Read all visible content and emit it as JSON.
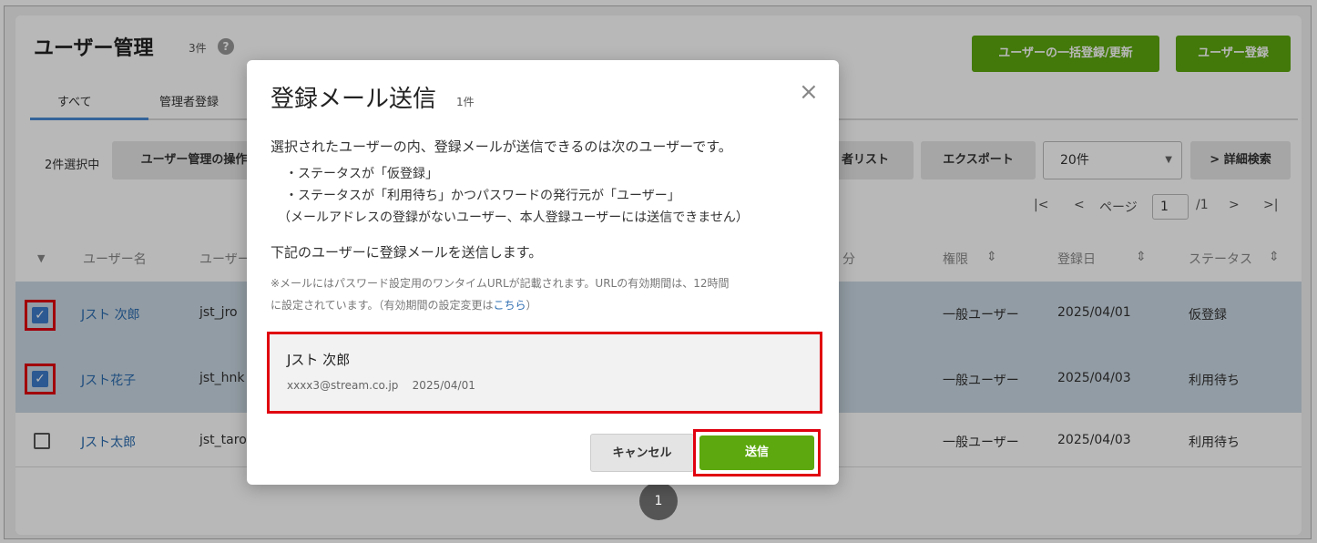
{
  "page": {
    "title": "ユーザー管理",
    "count": "3件",
    "help": "?",
    "bulk_button": "ユーザーの一括登録/更新",
    "register_button": "ユーザー登録"
  },
  "tabs": [
    {
      "label": "すべて"
    },
    {
      "label": "管理者登録"
    }
  ],
  "toolbar": {
    "selected": "2件選択中",
    "operation_button": "ユーザー管理の操作",
    "list_button": "者リスト",
    "export_button": "エクスポート",
    "per_page": "20件",
    "search_button": "> 詳細検索"
  },
  "pager": {
    "first": "|<",
    "prev": "<",
    "page_label": "ページ",
    "current": "1",
    "total": "/1",
    "next": ">",
    "last": ">|"
  },
  "table": {
    "headers": {
      "username": "ユーザー名",
      "userid": "ユーザー",
      "division": "分",
      "role": "権限",
      "registered": "登録日",
      "status": "ステータス"
    },
    "rows": [
      {
        "name": "Jスト 次郎",
        "id": "jst_jro",
        "role": "一般ユーザー",
        "date": "2025/04/01",
        "status": "仮登録",
        "checked": true
      },
      {
        "name": "Jスト花子",
        "id": "jst_hnk",
        "role": "一般ユーザー",
        "date": "2025/04/03",
        "status": "利用待ち",
        "checked": true
      },
      {
        "name": "Jスト太郎",
        "id": "jst_taro",
        "role": "一般ユーザー",
        "date": "2025/04/03",
        "status": "利用待ち",
        "checked": false
      }
    ]
  },
  "bottom_page": "1",
  "modal": {
    "title": "登録メール送信",
    "count": "1件",
    "close": "×",
    "intro": "選択されたユーザーの内、登録メールが送信できるのは次のユーザーです。",
    "bullet1": "・ステータスが「仮登録」",
    "bullet2": "・ステータスが「利用待ち」かつパスワードの発行元が「ユーザー」",
    "note": "（メールアドレスの登録がないユーザー、本人登録ユーザーには送信できません）",
    "send_text": "下記のユーザーに登録メールを送信します。",
    "small1": "※メールにはパスワード設定用のワンタイムURLが記載されます。URLの有効期間は、12時間",
    "small2_pre": "に設定されています。（有効期間の設定変更は",
    "small2_link": "こちら",
    "small2_post": "）",
    "user": {
      "name": "Jスト 次郎",
      "email": "xxxx3@stream.co.jp",
      "date": "2025/04/01"
    },
    "cancel_button": "キャンセル",
    "send_button": "送信"
  },
  "colors": {
    "accent": "#5ca80e",
    "highlight": "#e0000f",
    "selected_row": "#cbd8e3"
  }
}
